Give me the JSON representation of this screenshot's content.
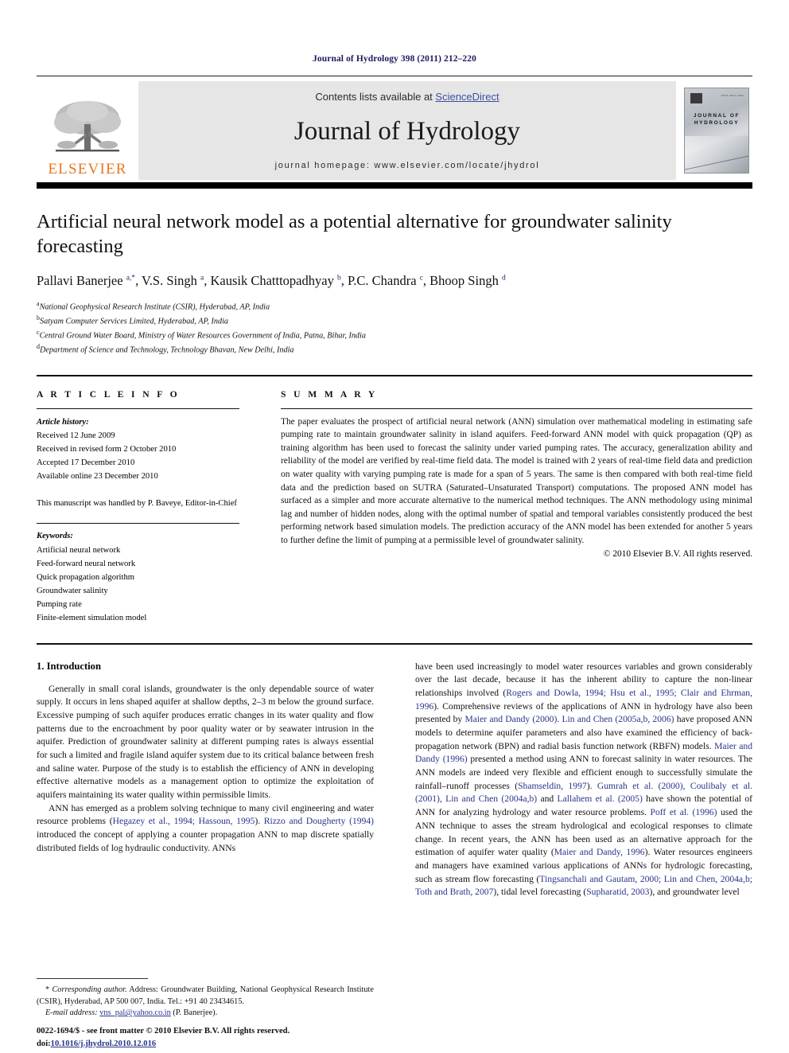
{
  "running_head": "Journal of Hydrology 398 (2011) 212–220",
  "masthead": {
    "publisher_logo_label": "ELSEVIER",
    "contents_prefix": "Contents lists available at ",
    "sciencedirect": "ScienceDirect",
    "journal_title": "Journal of Hydrology",
    "homepage": "journal homepage: www.elsevier.com/locate/jhydrol",
    "cover_title_line1": "JOURNAL OF",
    "cover_title_line2": "HYDROLOGY",
    "cover_corner_text": "ISSN 0022-1694",
    "sciencedirect_color": "#3b4fa0",
    "elsevier_orange": "#E87722"
  },
  "article": {
    "title": "Artificial neural network model as a potential alternative for groundwater salinity forecasting",
    "authors_html": "Pallavi Banerjee <sup>a,*</sup>, V.S. Singh <sup>a</sup>, Kausik Chatttopadhyay <sup>b</sup>, P.C. Chandra <sup>c</sup>, Bhoop Singh <sup>d</sup>",
    "affiliations": [
      {
        "marker": "a",
        "text": "National Geophysical Research Institute (CSIR), Hyderabad, AP, India"
      },
      {
        "marker": "b",
        "text": "Satyam Computer Services Limited, Hyderabad, AP, India"
      },
      {
        "marker": "c",
        "text": "Central Ground Water Board, Ministry of Water Resources Government of India, Patna, Bihar, India"
      },
      {
        "marker": "d",
        "text": "Department of Science and Technology, Technology Bhavan, New Delhi, India"
      }
    ]
  },
  "article_info": {
    "heading": "A R T I C L E    I N F O",
    "history_label": "Article history:",
    "history": [
      "Received 12 June 2009",
      "Received in revised form 2 October 2010",
      "Accepted 17 December 2010",
      "Available online 23 December 2010"
    ],
    "handled_by": "This manuscript was handled by P. Baveye, Editor-in-Chief",
    "keywords_label": "Keywords:",
    "keywords": [
      "Artificial neural network",
      "Feed-forward neural network",
      "Quick propagation algorithm",
      "Groundwater salinity",
      "Pumping rate",
      "Finite-element simulation model"
    ]
  },
  "summary": {
    "heading": "S U M M A R Y",
    "text": "The paper evaluates the prospect of artificial neural network (ANN) simulation over mathematical modeling in estimating safe pumping rate to maintain groundwater salinity in island aquifers. Feed-forward ANN model with quick propagation (QP) as training algorithm has been used to forecast the salinity under varied pumping rates. The accuracy, generalization ability and reliability of the model are verified by real-time field data. The model is trained with 2 years of real-time field data and prediction on water quality with varying pumping rate is made for a span of 5 years. The same is then compared with both real-time field data and the prediction based on SUTRA (Saturated–Unsaturated Transport) computations. The proposed ANN model has surfaced as a simpler and more accurate alternative to the numerical method techniques. The ANN methodology using minimal lag and number of hidden nodes, along with the optimal number of spatial and temporal variables consistently produced the best performing network based simulation models. The prediction accuracy of the ANN model has been extended for another 5 years to further define the limit of pumping at a permissible level of groundwater salinity.",
    "copyright": "© 2010 Elsevier B.V. All rights reserved."
  },
  "introduction": {
    "heading": "1. Introduction",
    "left_para1": "Generally in small coral islands, groundwater is the only dependable source of water supply. It occurs in lens shaped aquifer at shallow depths, 2–3 m below the ground surface. Excessive pumping of such aquifer produces erratic changes in its water quality and flow patterns due to the encroachment by poor quality water or by seawater intrusion in the aquifer. Prediction of groundwater salinity at different pumping rates is always essential for such a limited and fragile island aquifer system due to its critical balance between fresh and saline water. Purpose of the study is to establish the efficiency of ANN in developing effective alternative models as a management option to optimize the exploitation of aquifers maintaining its water quality within permissible limits.",
    "left_para2_html": "ANN has emerged as a problem solving technique to many civil engineering and water resource problems (<span class=\"ref\">Hegazey et al., 1994; Hassoun, 1995</span>). <span class=\"ref\">Rizzo and Dougherty (1994)</span> introduced the concept of applying a counter propagation ANN to map discrete spatially distributed fields of log hydraulic conductivity. ANNs",
    "right_para_html": "have been used increasingly to model water resources variables and grown considerably over the last decade, because it has the inherent ability to capture the non-linear relationships involved (<span class=\"ref\">Rogers and Dowla, 1994; Hsu et al., 1995; Clair and Ehrman, 1996</span>). Comprehensive reviews of the applications of ANN in hydrology have also been presented by <span class=\"ref\">Maier and Dandy (2000)</span>. <span class=\"ref\">Lin and Chen (2005a,b, 2006)</span> have proposed ANN models to determine aquifer parameters and also have examined the efficiency of back-propagation network (BPN) and radial basis function network (RBFN) models. <span class=\"ref\">Maier and Dandy (1996)</span> presented a method using ANN to forecast salinity in water resources. The ANN models are indeed very flexible and efficient enough to successfully simulate the rainfall–runoff processes (<span class=\"ref\">Shamseldin, 1997</span>). <span class=\"ref\">Gumrah et al. (2000), Coulibaly et al. (2001), Lin and Chen (2004a,b)</span> and <span class=\"ref\">Lallahem et al. (2005)</span> have shown the potential of ANN for analyzing hydrology and water resource problems. <span class=\"ref\">Poff et al. (1996)</span> used the ANN technique to asses the stream hydrological and ecological responses to climate change. In recent years, the ANN has been used as an alternative approach for the estimation of aquifer water quality (<span class=\"ref\">Maier and Dandy, 1996</span>). Water resources engineers and managers have examined various applications of ANNs for hydrologic forecasting, such as stream flow forecasting (<span class=\"ref\">Tingsanchali and Gautam, 2000; Lin and Chen, 2004a,b; Toth and Brath, 2007</span>), tidal level forecasting (<span class=\"ref\">Supharatid, 2003</span>), and groundwater level"
  },
  "footnote": {
    "corresponding_html": "* <i>Corresponding author.</i> Address: Groundwater Building, National Geophysical Research Institute (CSIR), Hyderabad, AP 500 007, India. Tel.: +91 40 23434615.",
    "email_label": "E-mail address:",
    "email": "vns_pal@yahoo.co.in",
    "email_owner": "(P. Banerjee)."
  },
  "imprint": {
    "issn_line": "0022-1694/$ - see front matter © 2010 Elsevier B.V. All rights reserved.",
    "doi_label": "doi:",
    "doi": "10.1016/j.jhydrol.2010.12.016"
  }
}
